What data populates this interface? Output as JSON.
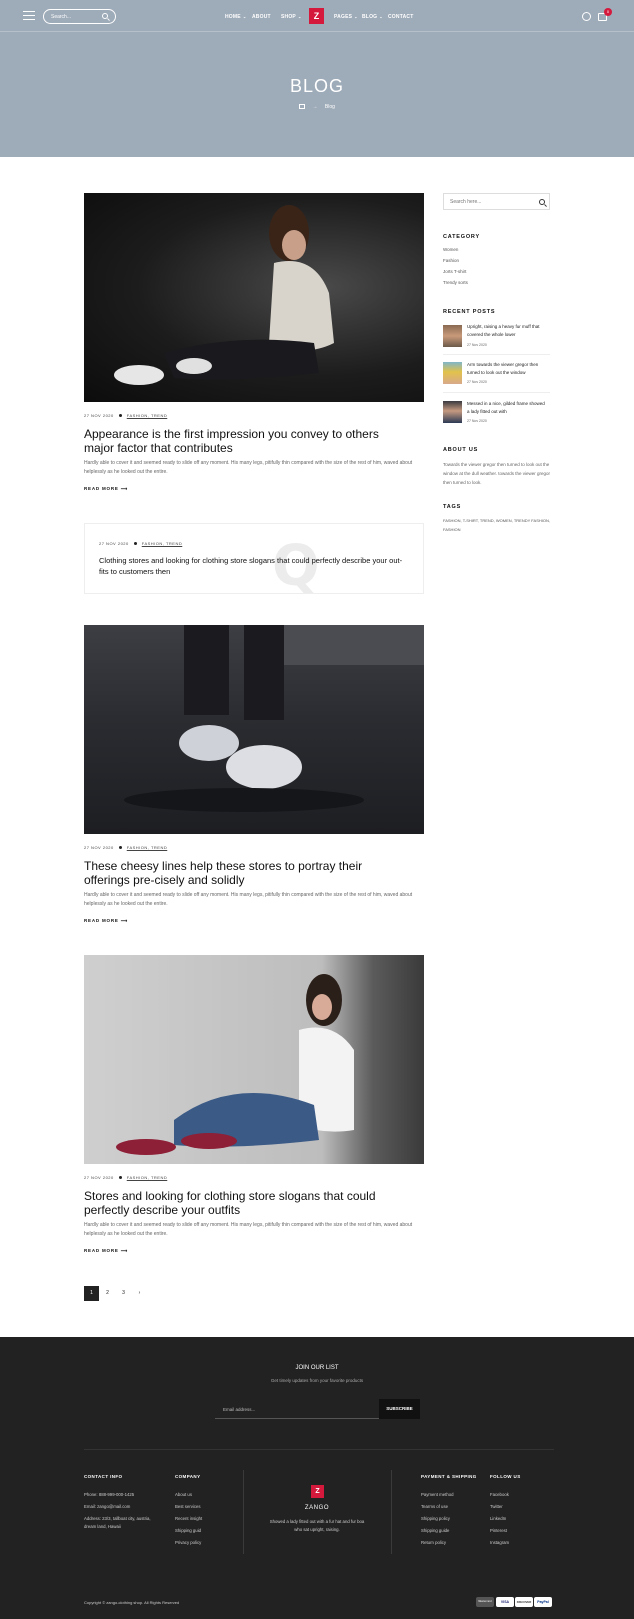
{
  "header": {
    "search_placeholder": "Search...",
    "nav": [
      "HOME",
      "ABOUT",
      "SHOP",
      "PAGES",
      "BLOG",
      "CONTACT"
    ],
    "logo": "Z",
    "cart_count": "0",
    "title": "BLOG",
    "breadcrumb_current": "Blog"
  },
  "posts": [
    {
      "date": "27 NOV 2020",
      "category": "FASHION, TREND",
      "title": "Appearance is the first impression you convey to others major factor that contributes",
      "excerpt": "Hardly able to cover it and seemed ready to slide off any moment. His many legs, pitifully thin compared with the size of the rest of him, waved about helplessly as he looked out the entire.",
      "read_more": "READ MORE"
    },
    {
      "date": "27 NOV 2020",
      "category": "FASHION, TREND",
      "title": "These cheesy lines help these stores to portray their offerings pre-cisely and solidly",
      "excerpt": "Hardly able to cover it and seemed ready to slide off any moment. His many legs, pitifully thin compared with the size of the rest of him, waved about helplessly as he looked out the entire.",
      "read_more": "READ MORE"
    },
    {
      "date": "27 NOV 2020",
      "category": "FASHION, TREND",
      "title": "Stores and looking for clothing store slogans that could perfectly describe your outfits",
      "excerpt": "Hardly able to cover it and seemed ready to slide off any moment. His many legs, pitifully thin compared with the size of the rest of him, waved about helplessly as he looked out the entire.",
      "read_more": "READ MORE"
    }
  ],
  "quote_post": {
    "date": "27 NOV 2020",
    "category": "FASHION, TREND",
    "text": "Clothing stores and looking for clothing store slogans that could perfectly describe your out-fits to customers then",
    "mark": "Q"
  },
  "pagination": [
    "1",
    "2",
    "3"
  ],
  "sidebar": {
    "search_placeholder": "Search here...",
    "category_heading": "CATEGORY",
    "categories": [
      "Women",
      "Fashion",
      "Jorts T-shirt",
      "Trendy sorts"
    ],
    "recent_heading": "RECENT POSTS",
    "recent_posts": [
      {
        "title": "Upright, raising a heavy fur muff that covered the whole lower",
        "date": "27 Nov 2020"
      },
      {
        "title": "Arm towards the viewer gregor then turned to look out the window",
        "date": "27 Nov 2020"
      },
      {
        "title": "Messed in a nice, gilded frame showed a lady fitted out with",
        "date": "27 Nov 2020"
      }
    ],
    "about_heading": "ABOUT US",
    "about_text": "Towards the viewer gregor then turned to look out the window at the dull weather. towards the viewer gregor then turned to look.",
    "tags_heading": "TAGS",
    "tags_text": "FASHION, T-SHIRT, TREND, WOMEN, TRENDY FASHION, FASHION"
  },
  "footer": {
    "join_heading": "JOIN OUR LIST",
    "join_sub": "Get timely updates from your favorite products",
    "email_placeholder": "Email address...",
    "subscribe": "SUBSCRIBE",
    "contact_heading": "CONTACT INFO",
    "contact_lines": [
      "Phone: 888-999-000-1425",
      "Email: zango@mail.com",
      "Address: 23/3, tallboat city, austria, dream land, Hawaii"
    ],
    "company_heading": "COMPANY",
    "company_links": [
      "About us",
      "Best services",
      "Recent insight",
      "Shipping guid",
      "Privacy policy"
    ],
    "logo": "Z",
    "brand": "ZANGO",
    "brand_desc": "Showed a lady fitted out with a fur hat and fur boa who sat upright, raising.",
    "payment_heading": "PAYMENT & SHIPPING",
    "payment_links": [
      "Payment method",
      "Tearms of use",
      "Shipping policy",
      "Shipping guide",
      "Return policy"
    ],
    "follow_heading": "FOLLOW US",
    "follow_links": [
      "Facebook",
      "Twitter",
      "LinkedIn",
      "Pinterest",
      "Instagram"
    ],
    "copyright": "Copyright © zango-clothing shop. All Rights Reserved",
    "payment_cards": [
      "Mastercard",
      "VISA",
      "DISCOVER",
      "PayPal"
    ]
  },
  "colors": {
    "accent": "#d5193c",
    "header_bg": "#9eabb8",
    "footer_bg": "#222222"
  }
}
